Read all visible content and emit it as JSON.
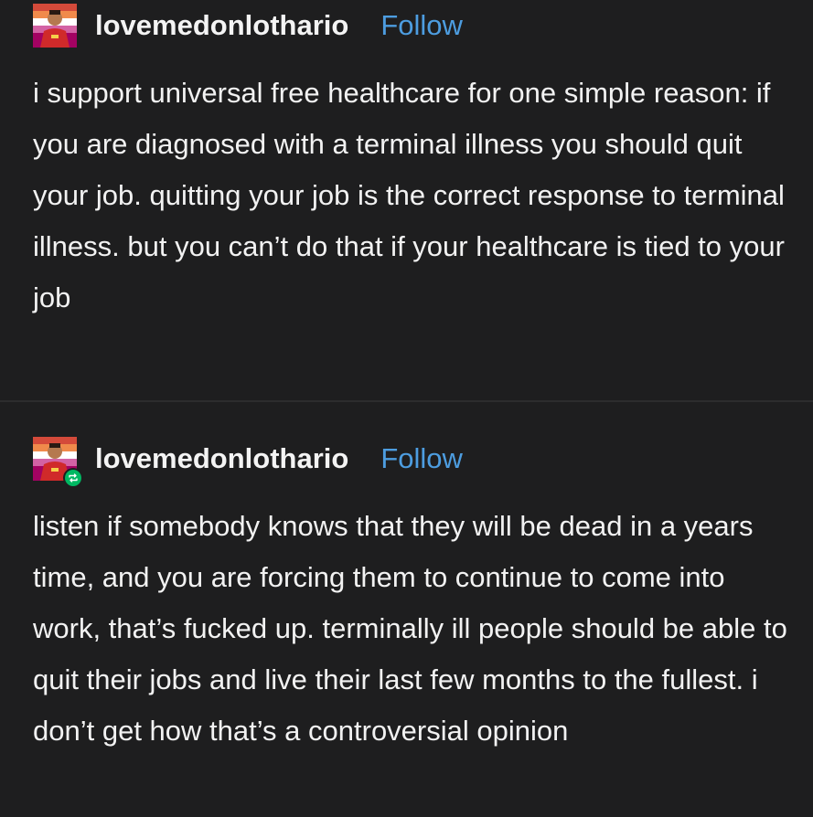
{
  "posts": [
    {
      "username": "lovemedonlothario",
      "follow_label": "Follow",
      "avatar_icon": "avatar-image",
      "text": "i support universal free healthcare for one simple reason: if you are diagnosed with a terminal illness you should quit your job. quitting your job is the correct response to terminal illness. but you can’t do that if your healthcare is tied to your job"
    },
    {
      "username": "lovemedonlothario",
      "follow_label": "Follow",
      "avatar_icon": "avatar-image",
      "badge_icon": "reblog-icon",
      "text": "listen if somebody knows that they will be dead in a years time, and you are forcing them to continue to come into work, that’s fucked up. terminally ill people should be able to quit their jobs and live their last few months to the fullest. i don’t get how that’s a controversial opinion"
    }
  ],
  "colors": {
    "background": "#1e1e1f",
    "text": "#f2f2f2",
    "follow": "#4d9de0",
    "reblog_badge": "#00b862"
  }
}
